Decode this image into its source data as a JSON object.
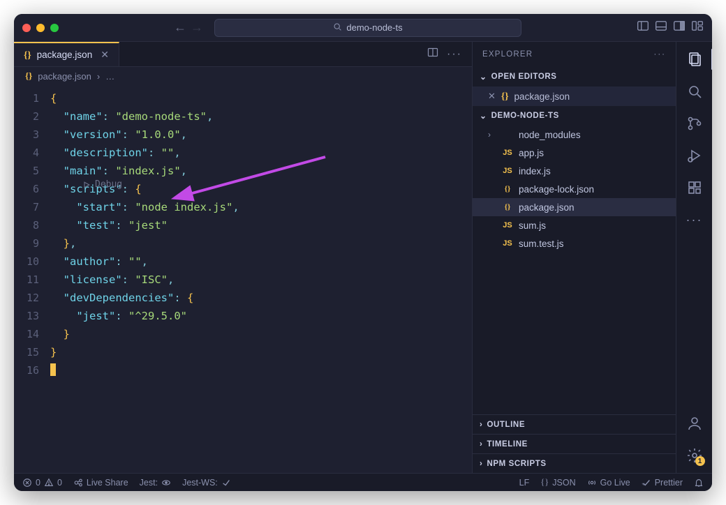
{
  "window": {
    "search_text": "demo-node-ts"
  },
  "tab": {
    "filename": "package.json",
    "icon": "{}"
  },
  "breadcrumb": {
    "filename": "package.json",
    "rest": "…"
  },
  "code": {
    "lines": [
      1,
      2,
      3,
      4,
      5,
      6,
      7,
      8,
      9,
      10,
      11,
      12,
      13,
      14,
      15,
      16
    ],
    "l1": "{",
    "l2_key": "\"name\"",
    "l2_val": "\"demo-node-ts\"",
    "l3_key": "\"version\"",
    "l3_val": "\"1.0.0\"",
    "l4_key": "\"description\"",
    "l4_val": "\"\"",
    "l5_key": "\"main\"",
    "l5_val": "\"index.js\"",
    "debug_lens": "Debug",
    "l6_key": "\"scripts\"",
    "l7_key": "\"start\"",
    "l7_val": "\"node index.js\"",
    "l8_key": "\"test\"",
    "l8_val": "\"jest\"",
    "l10_key": "\"author\"",
    "l10_val": "\"\"",
    "l11_key": "\"license\"",
    "l11_val": "\"ISC\"",
    "l12_key": "\"devDependencies\"",
    "l13_key": "\"jest\"",
    "l13_val": "\"^29.5.0\""
  },
  "explorer": {
    "title": "EXPLORER",
    "open_editors": "OPEN EDITORS",
    "open_editor_file": "package.json",
    "project": "DEMO-NODE-TS",
    "items": [
      {
        "kind": "folder",
        "label": "node_modules",
        "icon": ">"
      },
      {
        "kind": "js",
        "label": "app.js"
      },
      {
        "kind": "js",
        "label": "index.js"
      },
      {
        "kind": "json",
        "label": "package-lock.json"
      },
      {
        "kind": "json",
        "label": "package.json",
        "selected": true
      },
      {
        "kind": "js",
        "label": "sum.js"
      },
      {
        "kind": "js",
        "label": "sum.test.js"
      }
    ],
    "outline": "OUTLINE",
    "timeline": "TIMELINE",
    "npm": "NPM SCRIPTS"
  },
  "status": {
    "errors": "0",
    "warnings": "0",
    "live_share": "Live Share",
    "jest": "Jest:",
    "jest_ws": "Jest-WS:",
    "lf": "LF",
    "lang": "JSON",
    "lang_icon": "{}",
    "go_live": "Go Live",
    "prettier": "Prettier",
    "gear_badge": "1"
  }
}
